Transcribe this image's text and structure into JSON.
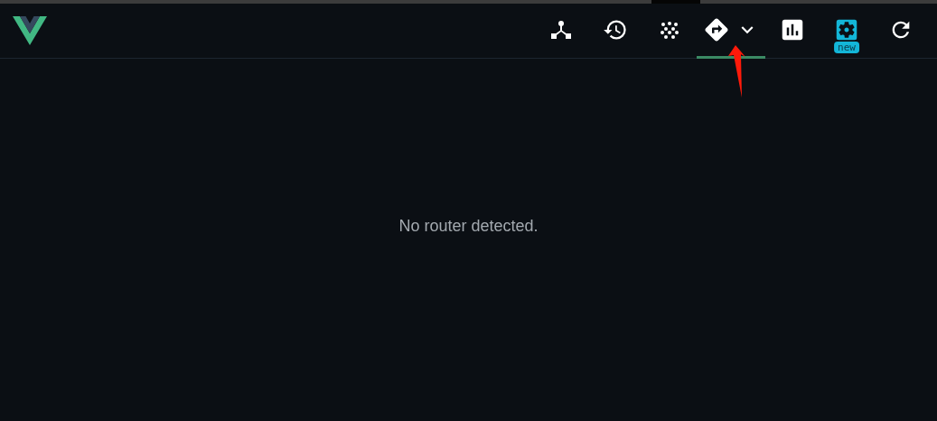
{
  "tabs": [
    {
      "kind": "tree",
      "selected": false,
      "dropdown": false,
      "highlighted": false
    },
    {
      "kind": "history",
      "selected": false,
      "dropdown": false,
      "highlighted": false
    },
    {
      "kind": "dots",
      "selected": false,
      "dropdown": false,
      "highlighted": false
    },
    {
      "kind": "routes",
      "selected": true,
      "dropdown": true,
      "highlighted": false
    },
    {
      "kind": "chart",
      "selected": false,
      "dropdown": false,
      "highlighted": false
    },
    {
      "kind": "settings",
      "selected": false,
      "dropdown": false,
      "highlighted": true,
      "badge": "new"
    },
    {
      "kind": "refresh",
      "selected": false,
      "dropdown": false,
      "highlighted": false
    }
  ],
  "message": "No router detected.",
  "annotation": {
    "kind": "arrow"
  }
}
